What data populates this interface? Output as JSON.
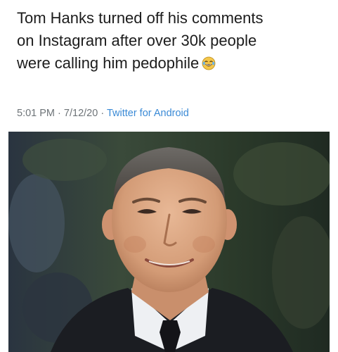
{
  "tweet": {
    "lines": [
      "Tom Hanks turned off his comments",
      "on Instagram after over 30k people",
      "were calling him pedophile"
    ],
    "emoji": "face-with-tears-of-joy-icon",
    "time": "5:01 PM",
    "separator": "·",
    "date": "7/12/20",
    "source": "Twitter for Android"
  },
  "photo": {
    "subject": "portrait-photo"
  },
  "colors": {
    "text": "#1c1c1c",
    "meta": "#6e7478",
    "link": "#3a8ad6"
  }
}
